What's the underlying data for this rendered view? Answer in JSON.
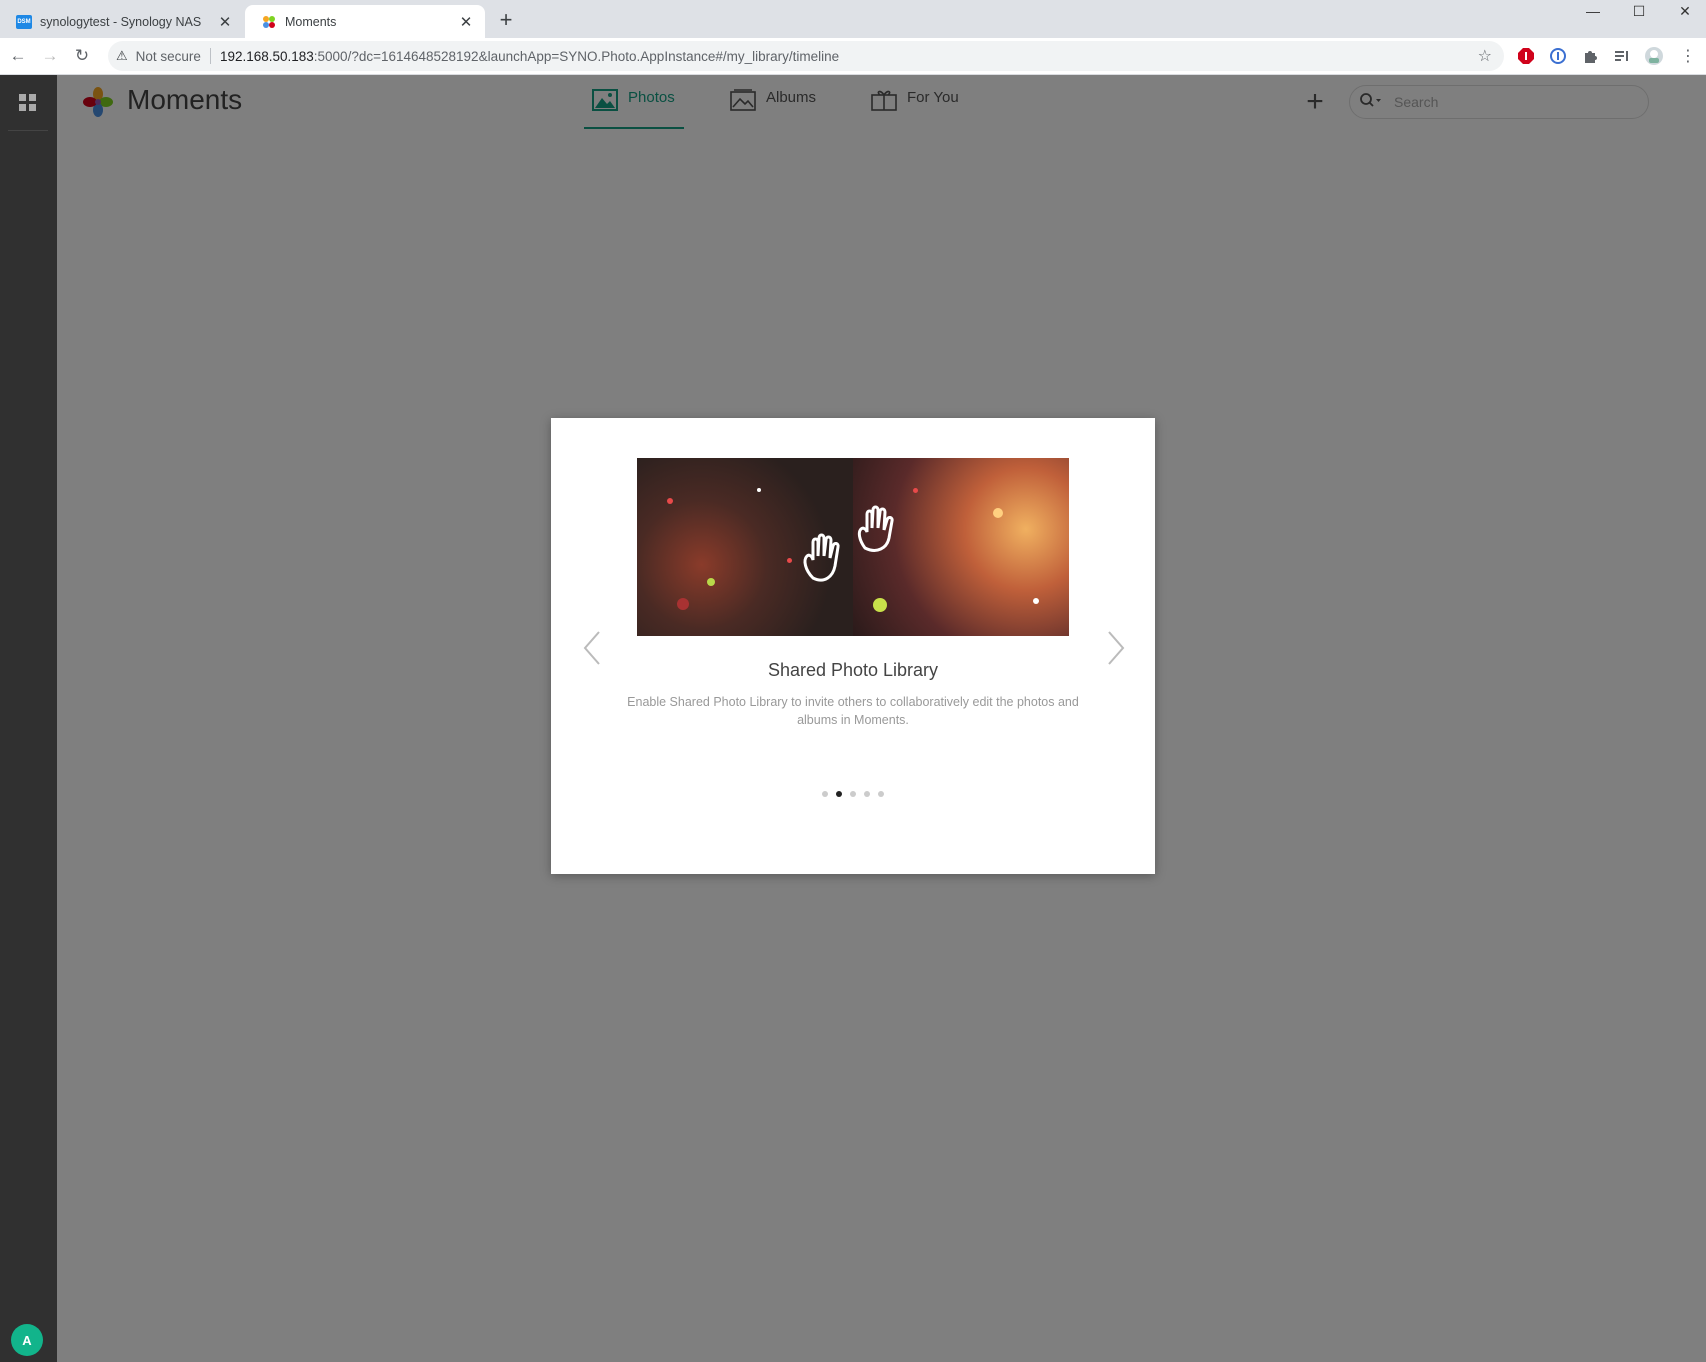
{
  "browser": {
    "tabs": [
      {
        "title": "synologytest - Synology NAS",
        "favicon": "dsm-icon",
        "active": false
      },
      {
        "title": "Moments",
        "favicon": "moments-icon",
        "active": true
      }
    ],
    "dsm_favicon_text": "DSM",
    "not_secure": "Not secure",
    "url_host": "192.168.50.183",
    "url_rest": ":5000/?dc=1614648528192&launchApp=SYNO.Photo.AppInstance#/my_library/timeline"
  },
  "app": {
    "title": "Moments",
    "nav": [
      {
        "label": "Photos",
        "icon": "photos-icon",
        "active": true
      },
      {
        "label": "Albums",
        "icon": "albums-icon",
        "active": false
      },
      {
        "label": "For You",
        "icon": "gift-icon",
        "active": false
      }
    ],
    "search_placeholder": "Search",
    "avatar_initial": "A",
    "accent_color": "#14a085"
  },
  "modal": {
    "slide_title": "Shared Photo Library",
    "slide_description": "Enable Shared Photo Library to invite others to collaboratively edit the photos and albums in Moments.",
    "dots_total": 5,
    "dots_active_index": 1
  }
}
